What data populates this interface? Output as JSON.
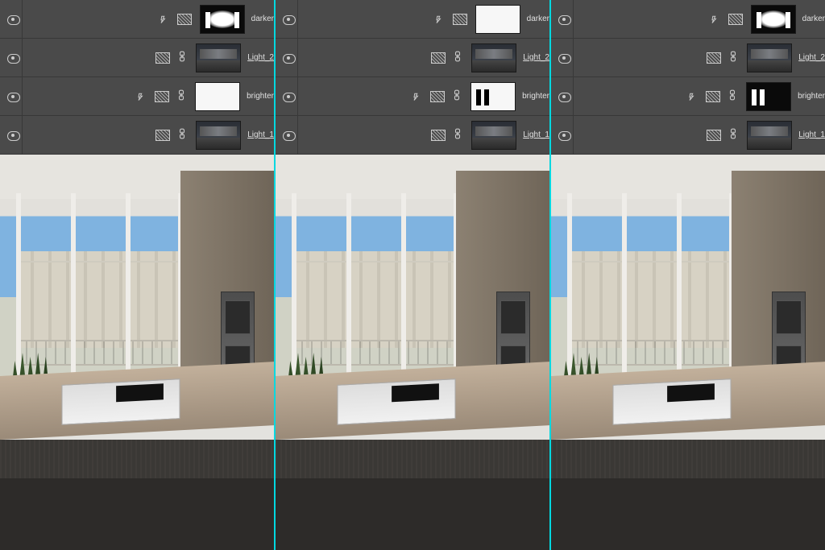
{
  "columns": [
    {
      "layers": [
        {
          "name": "darker",
          "underline": false,
          "hasFx": true,
          "hasAdj": true,
          "hasLink": false,
          "thumbStyle": "mask-oval with-bars"
        },
        {
          "name": "Light_2",
          "underline": true,
          "hasFx": false,
          "hasAdj": true,
          "hasLink": true,
          "thumbStyle": "photo"
        },
        {
          "name": "brighter",
          "underline": false,
          "hasFx": true,
          "hasAdj": true,
          "hasLink": true,
          "thumbStyle": "mask-white"
        },
        {
          "name": "Light_1",
          "underline": true,
          "hasFx": false,
          "hasAdj": true,
          "hasLink": true,
          "thumbStyle": "photo"
        }
      ]
    },
    {
      "layers": [
        {
          "name": "darker",
          "underline": false,
          "hasFx": true,
          "hasAdj": true,
          "hasLink": false,
          "thumbStyle": "mask-white"
        },
        {
          "name": "Light_2",
          "underline": true,
          "hasFx": false,
          "hasAdj": true,
          "hasLink": true,
          "thumbStyle": "photo"
        },
        {
          "name": "brighter",
          "underline": false,
          "hasFx": true,
          "hasAdj": true,
          "hasLink": true,
          "thumbStyle": "mask-bars"
        },
        {
          "name": "Light_1",
          "underline": true,
          "hasFx": false,
          "hasAdj": true,
          "hasLink": true,
          "thumbStyle": "photo"
        }
      ]
    },
    {
      "layers": [
        {
          "name": "darker",
          "underline": false,
          "hasFx": true,
          "hasAdj": true,
          "hasLink": false,
          "thumbStyle": "mask-oval with-bars"
        },
        {
          "name": "Light_2",
          "underline": true,
          "hasFx": false,
          "hasAdj": true,
          "hasLink": true,
          "thumbStyle": "photo"
        },
        {
          "name": "brighter",
          "underline": false,
          "hasFx": true,
          "hasAdj": true,
          "hasLink": true,
          "thumbStyle": "mask-bars invert"
        },
        {
          "name": "Light_1",
          "underline": true,
          "hasFx": false,
          "hasAdj": true,
          "hasLink": true,
          "thumbStyle": "photo"
        }
      ]
    }
  ]
}
